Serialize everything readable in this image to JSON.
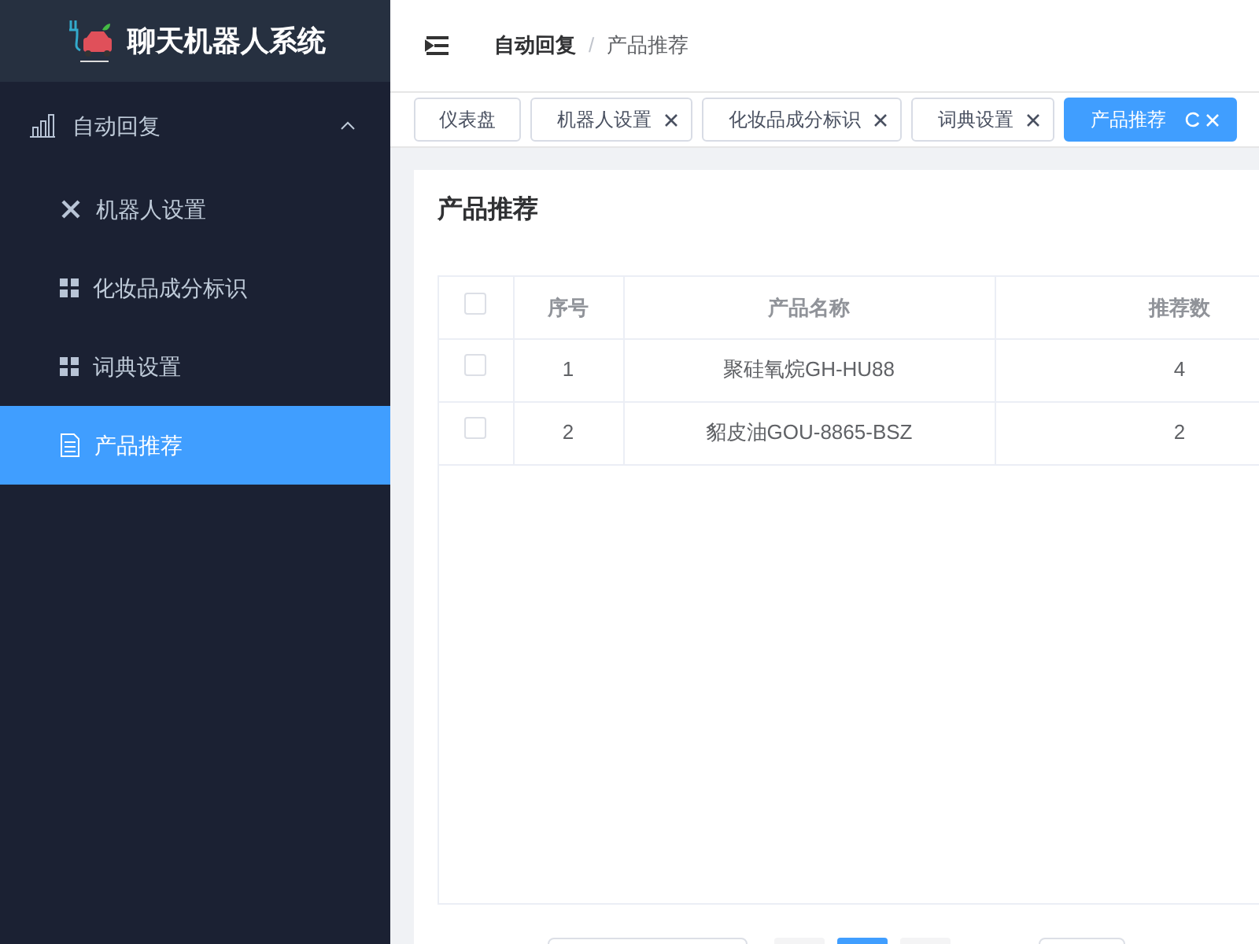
{
  "app": {
    "title": "聊天机器人系统"
  },
  "sidebar": {
    "groups": [
      {
        "label": "自动回复",
        "expanded": true,
        "children": [
          {
            "label": "机器人设置",
            "kind": "tools",
            "selected": false
          },
          {
            "label": "化妆品成分标识",
            "kind": "grid",
            "selected": false
          },
          {
            "label": "词典设置",
            "kind": "grid",
            "selected": false
          },
          {
            "label": "产品推荐",
            "kind": "document",
            "selected": true
          }
        ]
      }
    ]
  },
  "breadcrumb": {
    "items": [
      "自动回复",
      "产品推荐"
    ],
    "separator": "/"
  },
  "tabs": [
    {
      "label": "仪表盘",
      "closable": false,
      "selected": false
    },
    {
      "label": "机器人设置",
      "closable": true,
      "selected": false
    },
    {
      "label": "化妆品成分标识",
      "closable": true,
      "selected": false
    },
    {
      "label": "词典设置",
      "closable": true,
      "selected": false
    },
    {
      "label": "产品推荐",
      "closable": true,
      "selected": true
    }
  ],
  "card": {
    "title": "产品推荐"
  },
  "table": {
    "columns": [
      "序号",
      "产品名称",
      "推荐数"
    ],
    "header_checked": false,
    "rows": [
      {
        "checked": false,
        "cells": [
          "1",
          "聚硅氧烷GH-HU88",
          "4"
        ]
      },
      {
        "checked": false,
        "cells": [
          "2",
          "貂皮油GOU-8865-BSZ",
          "2"
        ]
      }
    ]
  },
  "pagination": {
    "pages": [
      {
        "selected": false
      },
      {
        "selected": true
      },
      {
        "selected": false
      }
    ]
  }
}
